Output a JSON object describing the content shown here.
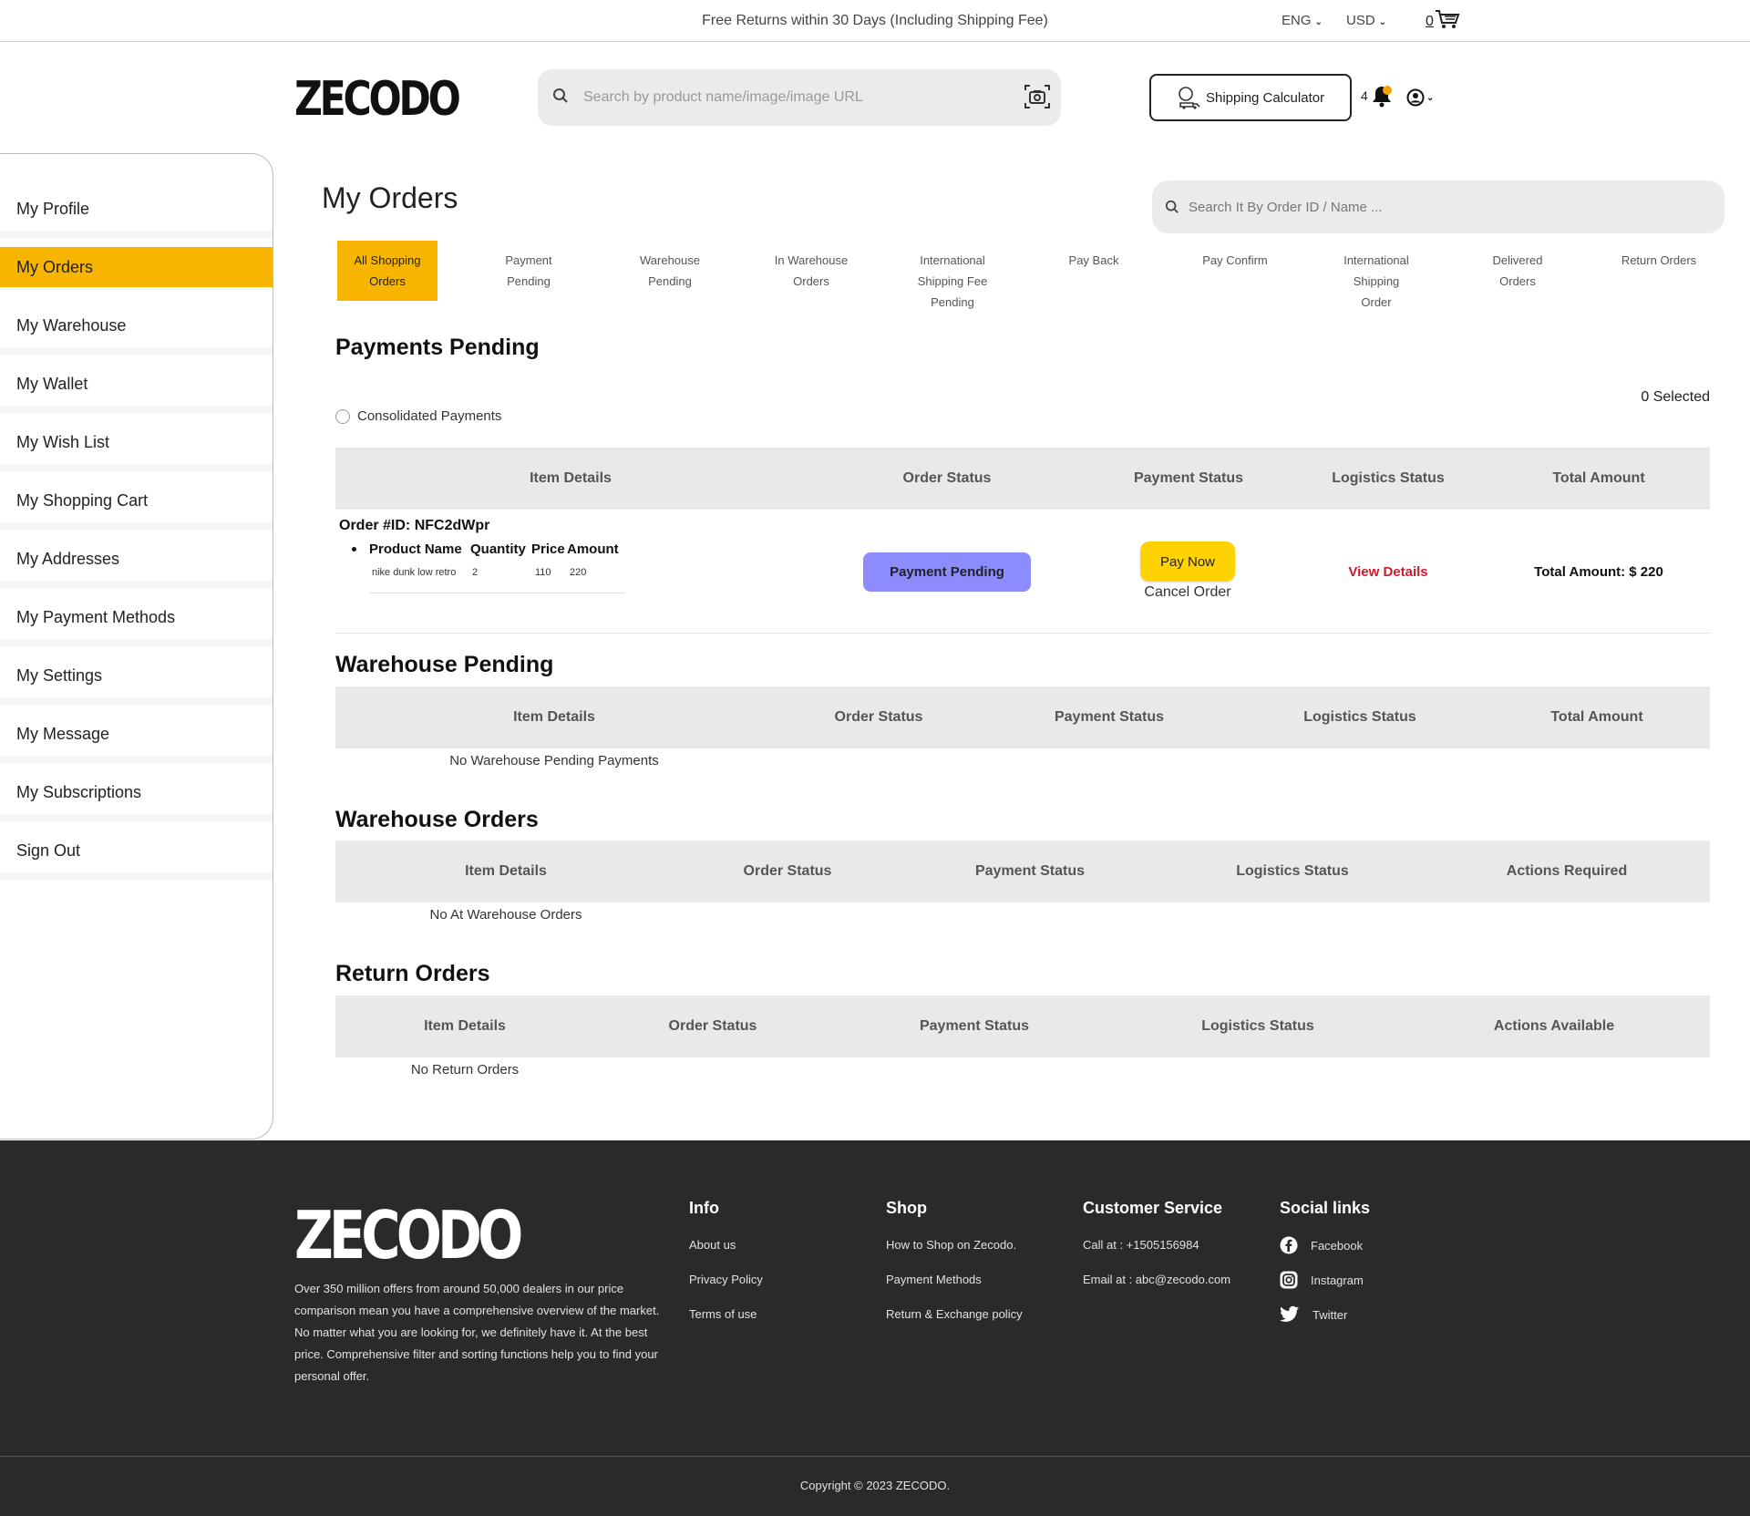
{
  "topbar": {
    "promo": "Free Returns within 30 Days (Including Shipping Fee)",
    "language": "ENG",
    "currency": "USD",
    "cart_count": "0"
  },
  "header": {
    "logo": "ZECODO",
    "search_placeholder": "Search by product name/image/image URL",
    "shipping_calculator": "Shipping Calculator",
    "notification_count": "4"
  },
  "sidebar": {
    "items": [
      {
        "label": "My Profile"
      },
      {
        "label": "My Orders",
        "active": true
      },
      {
        "label": "My Warehouse"
      },
      {
        "label": "My Wallet"
      },
      {
        "label": "My Wish List"
      },
      {
        "label": "My Shopping Cart"
      },
      {
        "label": "My Addresses"
      },
      {
        "label": "My Payment Methods"
      },
      {
        "label": "My Settings"
      },
      {
        "label": "My Message"
      },
      {
        "label": "My Subscriptions"
      },
      {
        "label": "Sign Out"
      }
    ]
  },
  "main": {
    "title": "My Orders",
    "order_search_placeholder": "Search It By Order ID / Name ...",
    "tabs": [
      {
        "line1": "All Shopping",
        "line2": "Orders",
        "line3": ""
      },
      {
        "line1": "Payment",
        "line2": "Pending",
        "line3": ""
      },
      {
        "line1": "Warehouse",
        "line2": "Pending",
        "line3": ""
      },
      {
        "line1": "In Warehouse",
        "line2": "Orders",
        "line3": ""
      },
      {
        "line1": "International",
        "line2": "Shipping Fee",
        "line3": "Pending"
      },
      {
        "line1": "Pay Back",
        "line2": "",
        "line3": ""
      },
      {
        "line1": "Pay Confirm",
        "line2": "",
        "line3": ""
      },
      {
        "line1": "International",
        "line2": "Shipping",
        "line3": "Order"
      },
      {
        "line1": "Delivered",
        "line2": "Orders",
        "line3": ""
      },
      {
        "line1": "Return Orders",
        "line2": "",
        "line3": ""
      }
    ],
    "payments_pending": {
      "title": "Payments Pending",
      "consolidated_label": "Consolidated Payments",
      "selected": "0 Selected",
      "headers": [
        "Item Details",
        "Order Status",
        "Payment Status",
        "Logistics Status",
        "Total Amount"
      ],
      "order": {
        "id_label": "Order #ID: NFC2dWpr",
        "product_headers": [
          "Product Name",
          "Quantity",
          "Price",
          "Amount"
        ],
        "product_row": [
          "nike dunk low retro",
          "2",
          "110",
          "220"
        ],
        "order_status": "Payment Pending",
        "pay_now": "Pay Now",
        "cancel": "Cancel Order",
        "view_details": "View Details",
        "total": "Total Amount: $ 220"
      }
    },
    "warehouse_pending": {
      "title": "Warehouse Pending",
      "headers": [
        "Item Details",
        "Order Status",
        "Payment Status",
        "Logistics Status",
        "Total Amount"
      ],
      "empty": "No Warehouse Pending Payments"
    },
    "warehouse_orders": {
      "title": "Warehouse Orders",
      "headers": [
        "Item Details",
        "Order Status",
        "Payment Status",
        "Logistics Status",
        "Actions Required"
      ],
      "empty": "No At Warehouse Orders"
    },
    "return_orders": {
      "title": "Return Orders",
      "headers": [
        "Item Details",
        "Order Status",
        "Payment Status",
        "Logistics Status",
        "Actions Available"
      ],
      "empty": "No Return Orders"
    }
  },
  "footer": {
    "logo": "ZECODO",
    "description": "Over 350 million offers from around 50,000 dealers in our price comparison mean you have a comprehensive overview of the market. No matter what you are looking for, we definitely have it. At the best price. Comprehensive filter and sorting functions help you to find your personal offer.",
    "info": {
      "title": "Info",
      "links": [
        "About us",
        "Privacy Policy",
        "Terms of use"
      ]
    },
    "shop": {
      "title": "Shop",
      "links": [
        "How to Shop on Zecodo.",
        "Payment Methods",
        "Return & Exchange policy"
      ]
    },
    "customer_service": {
      "title": "Customer Service",
      "links": [
        "Call at : +1505156984",
        "Email at : abc@zecodo.com"
      ]
    },
    "social": {
      "title": "Social links",
      "links": [
        "Facebook",
        "Instagram",
        "Twitter"
      ]
    },
    "copyright": "Copyright © 2023 ZECODO."
  },
  "colors": {
    "accent": "#f8b500",
    "pay_button": "#ffd200",
    "status_pill": "#8c8cff",
    "link_red": "#d0192b",
    "footer_bg": "#2a2a2a"
  },
  "icons": [
    "chevron-down-icon",
    "cart-icon",
    "search-icon",
    "camera-icon",
    "shipping-icon",
    "bell-icon",
    "user-icon",
    "facebook-icon",
    "instagram-icon",
    "twitter-icon"
  ]
}
